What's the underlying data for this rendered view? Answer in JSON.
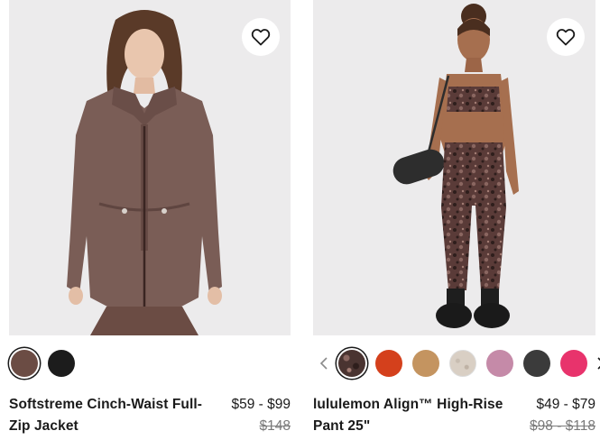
{
  "products": [
    {
      "name": "Softstreme Cinch-Waist Full-Zip Jacket",
      "price": "$59 - $99",
      "original_price": "$148",
      "swatches": [
        {
          "color": "#6b4c44",
          "selected": true
        },
        {
          "color": "#1c1c1c",
          "selected": false
        }
      ],
      "icons": {
        "wishlist": "heart-icon"
      }
    },
    {
      "name": "lululemon Align™ High-Rise Pant 25\"",
      "price": "$49 - $79",
      "original_price": "$98 - $118",
      "swatches": [
        {
          "color": "#4a3431",
          "selected": true,
          "pattern": "leopard"
        },
        {
          "color": "#d4401c",
          "selected": false
        },
        {
          "color": "#c49460",
          "selected": false
        },
        {
          "color": "#d9cfc4",
          "selected": false,
          "pattern": "heather"
        },
        {
          "color": "#c58aa8",
          "selected": false
        },
        {
          "color": "#3b3b3b",
          "selected": false
        },
        {
          "color": "#e8336c",
          "selected": false
        }
      ],
      "icons": {
        "wishlist": "heart-icon",
        "prev": "chevron-left-icon",
        "next": "chevron-right-icon"
      }
    }
  ]
}
